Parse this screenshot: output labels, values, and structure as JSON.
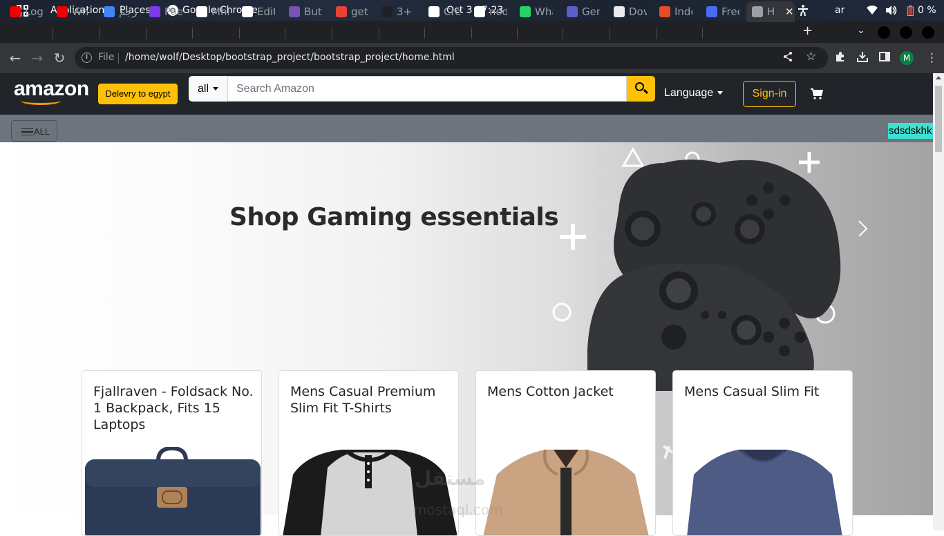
{
  "system_bar": {
    "applications": "Applications",
    "places": "Places",
    "active_app": "Google Chrome",
    "datetime": "Oct 3  07:23",
    "keyboard_layout": "ar",
    "battery": "0 %"
  },
  "browser": {
    "tabs": [
      {
        "label": "Log",
        "icon": "redhat-icon",
        "color": "#ee0000"
      },
      {
        "label": "Wh",
        "icon": "redhat-icon",
        "color": "#ee0000"
      },
      {
        "label": "ترجم",
        "icon": "translate-icon",
        "color": "#4285f4"
      },
      {
        "label": "Poe",
        "icon": "poe-icon",
        "color": "#7c3aed"
      },
      {
        "label": "Mhr",
        "icon": "github-icon",
        "color": "#ffffff"
      },
      {
        "label": "Edit",
        "icon": "github-icon",
        "color": "#ffffff"
      },
      {
        "label": "Butt",
        "icon": "bootstrap-icon",
        "color": "#7952b3"
      },
      {
        "label": "get",
        "icon": "google-icon",
        "color": "#ea4335"
      },
      {
        "label": "3+ V",
        "icon": "blank-icon",
        "color": "#202124"
      },
      {
        "label": "Cre",
        "icon": "github-icon",
        "color": "#ffffff"
      },
      {
        "label": "nod",
        "icon": "github-icon",
        "color": "#ffffff"
      },
      {
        "label": "Wha",
        "icon": "whatsapp-icon",
        "color": "#25d366"
      },
      {
        "label": "Gen",
        "icon": "teams-icon",
        "color": "#5b5fc7"
      },
      {
        "label": "Dov",
        "icon": "download-icon",
        "color": "#e8eaed"
      },
      {
        "label": "Inde",
        "icon": "html-icon",
        "color": "#e44d26"
      },
      {
        "label": "Free",
        "icon": "feather-icon",
        "color": "#4a6cf7"
      },
      {
        "label": "H",
        "icon": "globe-icon",
        "color": "#9aa0a6"
      }
    ],
    "address": {
      "scheme_label": "File",
      "url": "/home/wolf/Desktop/bootstrap_project/bootstrap_project/home.html"
    },
    "profile_initial": "M"
  },
  "page": {
    "logo": "amazon",
    "deliver_label": "Delevry to egypt",
    "category_select": "all",
    "search_placeholder": "Search Amazon",
    "language_label": "Language",
    "signin_label": "Sign-in",
    "all_menu_label": "ALL",
    "highlight_text": "sdsdskhk",
    "hero_title": "Shop Gaming essentials",
    "products": [
      {
        "title": "Fjallraven - Foldsack No. 1 Backpack, Fits 15 Laptops"
      },
      {
        "title": "Mens Casual Premium Slim Fit T-Shirts"
      },
      {
        "title": "Mens Cotton Jacket"
      },
      {
        "title": "Mens Casual Slim Fit"
      }
    ],
    "watermark": "مستقل",
    "watermark_sub": "mostaql.com"
  },
  "colors": {
    "accent": "#ffc107",
    "nav_dark": "#212529",
    "subnav": "#6c757d",
    "highlight": "#40e0d0"
  }
}
